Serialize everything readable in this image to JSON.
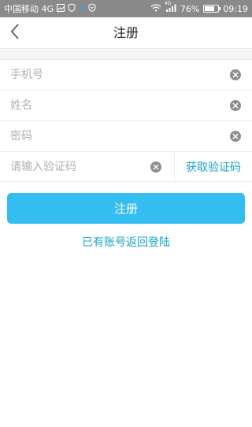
{
  "status_bar": {
    "carrier": "中国移动 4G",
    "network": "4G",
    "battery": "76%",
    "battery_level": 0.76,
    "time": "09:19"
  },
  "header": {
    "title": "注册",
    "back_icon": "chevron-left-icon"
  },
  "form": {
    "phone": {
      "value": "",
      "placeholder": "手机号"
    },
    "name": {
      "value": "",
      "placeholder": "姓名"
    },
    "password": {
      "value": "",
      "placeholder": "密码"
    },
    "code": {
      "value": "",
      "placeholder": "请输入验证码"
    },
    "get_code_label": "获取验证码",
    "clear_icon": "clear-circle-icon"
  },
  "actions": {
    "register_label": "注册",
    "login_link_label": "已有账号返回登陆"
  },
  "colors": {
    "accent": "#33bdf0",
    "link": "#1aa6c7",
    "status_bar": "#8a8a8a"
  }
}
